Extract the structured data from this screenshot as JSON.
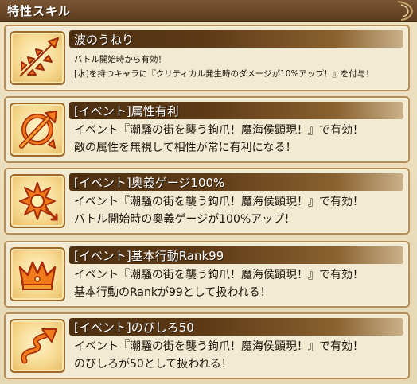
{
  "header": {
    "title": "特性スキル"
  },
  "skills": [
    {
      "name": "波のうねり",
      "icon": "attack-arrows-icon",
      "desc_lines": [
        "バトル開始時から有効！",
        "[水]を持つキャラに『クリティカル発生時のダメージが10%アップ！』を付与！"
      ]
    },
    {
      "name": "[イベント]属性有利",
      "icon": "element-crosshair-icon",
      "desc_lines": [
        "イベント『潮騒の街を襲う鉤爪！魔海侯顕現！』で有効！",
        "敵の属性を無視して相性が常に有利になる！"
      ]
    },
    {
      "name": "[イベント]奥義ゲージ100%",
      "icon": "burst-gauge-icon",
      "desc_lines": [
        "イベント『潮騒の街を襲う鉤爪！魔海侯顕現！』で有効！",
        "バトル開始時の奥義ゲージが100%アップ！"
      ]
    },
    {
      "name": "[イベント]基本行動Rank99",
      "icon": "crown-icon",
      "desc_lines": [
        "イベント『潮騒の街を襲う鉤爪！魔海侯顕現！』で有効！",
        "基本行動のRankが99として扱われる！"
      ]
    },
    {
      "name": "[イベント]のびしろ50",
      "icon": "spiral-arrow-icon",
      "desc_lines": [
        "イベント『潮騒の街を襲う鉤爪！魔海侯顕現！』で有効！",
        "のびしろが50として扱われる！"
      ]
    }
  ]
}
